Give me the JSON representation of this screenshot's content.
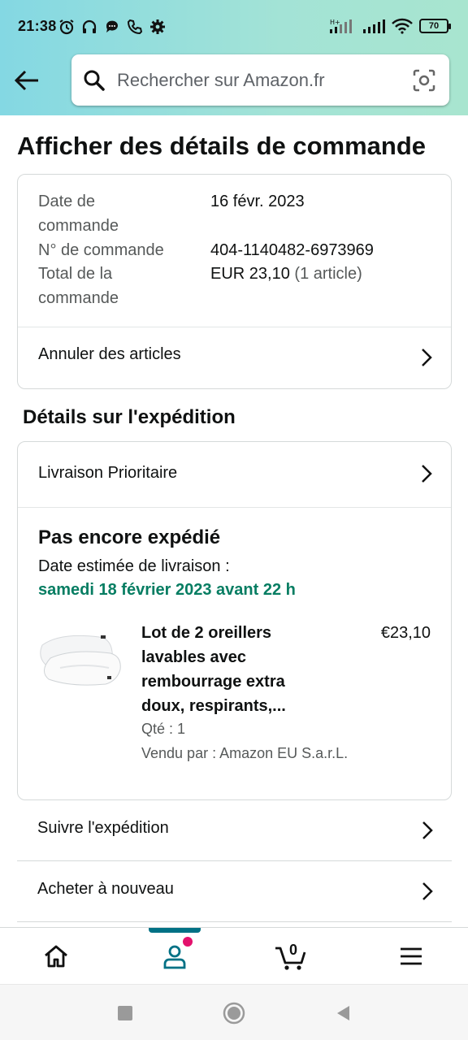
{
  "status_bar": {
    "time": "21:38",
    "battery": "70",
    "icons_left": [
      "alarm-icon",
      "headphones-icon",
      "chat-icon",
      "phone-icon",
      "settings-icon"
    ],
    "icons_right": [
      "hplus-signal-icon",
      "signal-icon",
      "wifi-icon",
      "battery-icon"
    ]
  },
  "header": {
    "search_placeholder": "Rechercher sur Amazon.fr",
    "accent": "#84d8e3"
  },
  "page": {
    "title": "Afficher des détails de commande"
  },
  "order_summary": {
    "date_label_1": "Date de",
    "date_label_2": "commande",
    "date_value": "16 févr. 2023",
    "number_label": "N° de commande",
    "number_value": "404-1140482-6973969",
    "total_label_1": "Total de la",
    "total_label_2": "commande",
    "total_value": "EUR 23,10",
    "total_items": "(1 article)",
    "cancel_link": "Annuler des articles"
  },
  "shipment": {
    "section_title": "Détails sur l'expédition",
    "delivery_option": "Livraison Prioritaire",
    "status": "Pas encore expédié",
    "estimated_label": "Date estimée de livraison :",
    "estimated_date": "samedi 18 février 2023 avant 22 h",
    "estimated_color": "#067d62",
    "product": {
      "title": "Lot de 2 oreillers lavables avec rembourrage extra doux, respirants,...",
      "price": "€23,10",
      "quantity": "Qté : 1",
      "seller": "Vendu par : Amazon EU S.a.r.L."
    }
  },
  "actions": {
    "track": "Suivre l'expédition",
    "buy_again": "Acheter à nouveau"
  },
  "bottom_nav": {
    "cart_count": "0",
    "active_color": "#007185",
    "badge_color": "#e3126d"
  }
}
